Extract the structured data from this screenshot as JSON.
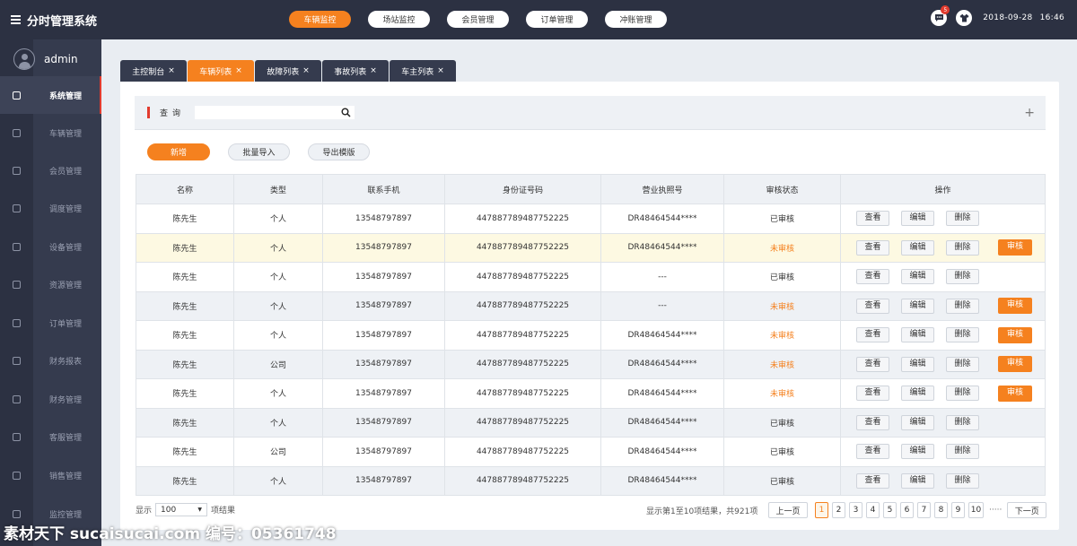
{
  "app": {
    "title": "分时管理系统"
  },
  "topnav": [
    {
      "label": "车辆监控",
      "active": true
    },
    {
      "label": "场站监控",
      "active": false
    },
    {
      "label": "会员管理",
      "active": false
    },
    {
      "label": "订单管理",
      "active": false
    },
    {
      "label": "冲账管理",
      "active": false
    }
  ],
  "header": {
    "message_count": "5",
    "date": "2018-09-28",
    "time": "16:46"
  },
  "user": {
    "name": "admin"
  },
  "sidebar": {
    "items": [
      {
        "label": "系统管理",
        "icon": "monitor-icon"
      },
      {
        "label": "车辆管理",
        "icon": "car-icon"
      },
      {
        "label": "会员管理",
        "icon": "member-card-icon"
      },
      {
        "label": "调度管理",
        "icon": "dispatch-icon"
      },
      {
        "label": "设备管理",
        "icon": "phone-icon"
      },
      {
        "label": "资源管理",
        "icon": "toolbox-icon"
      },
      {
        "label": "订单管理",
        "icon": "order-icon"
      },
      {
        "label": "财务报表",
        "icon": "report-icon"
      },
      {
        "label": "财务管理",
        "icon": "lock-icon"
      },
      {
        "label": "客服管理",
        "icon": "headset-icon"
      },
      {
        "label": "销售管理",
        "icon": "sales-icon"
      },
      {
        "label": "监控管理",
        "icon": "monitor-icon"
      }
    ]
  },
  "tabs": [
    {
      "label": "主控制台",
      "active": false
    },
    {
      "label": "车辆列表",
      "active": true
    },
    {
      "label": "故障列表",
      "active": false
    },
    {
      "label": "事故列表",
      "active": false
    },
    {
      "label": "车主列表",
      "active": false
    }
  ],
  "tab_close": "×",
  "search": {
    "label": "查询",
    "value": "",
    "plus": "+"
  },
  "actions": {
    "add": "新增",
    "import": "批量导入",
    "export": "导出模版"
  },
  "table": {
    "columns": [
      "名称",
      "类型",
      "联系手机",
      "身份证号码",
      "营业执照号",
      "审核状态",
      "操作"
    ],
    "ops": {
      "view": "查看",
      "edit": "编辑",
      "delete": "删除",
      "audit": "审核"
    },
    "rows": [
      {
        "name": "陈先生",
        "type": "个人",
        "phone": "13548797897",
        "id": "447887789487752225",
        "license": "DR48464544****",
        "status": "已审核",
        "pending": false
      },
      {
        "name": "陈先生",
        "type": "个人",
        "phone": "13548797897",
        "id": "447887789487752225",
        "license": "DR48464544****",
        "status": "未审核",
        "pending": true
      },
      {
        "name": "陈先生",
        "type": "个人",
        "phone": "13548797897",
        "id": "447887789487752225",
        "license": "---",
        "status": "已审核",
        "pending": false
      },
      {
        "name": "陈先生",
        "type": "个人",
        "phone": "13548797897",
        "id": "447887789487752225",
        "license": "---",
        "status": "未审核",
        "pending": true
      },
      {
        "name": "陈先生",
        "type": "个人",
        "phone": "13548797897",
        "id": "447887789487752225",
        "license": "DR48464544****",
        "status": "未审核",
        "pending": true
      },
      {
        "name": "陈先生",
        "type": "公司",
        "phone": "13548797897",
        "id": "447887789487752225",
        "license": "DR48464544****",
        "status": "未审核",
        "pending": true
      },
      {
        "name": "陈先生",
        "type": "个人",
        "phone": "13548797897",
        "id": "447887789487752225",
        "license": "DR48464544****",
        "status": "未审核",
        "pending": true
      },
      {
        "name": "陈先生",
        "type": "个人",
        "phone": "13548797897",
        "id": "447887789487752225",
        "license": "DR48464544****",
        "status": "已审核",
        "pending": false
      },
      {
        "name": "陈先生",
        "type": "公司",
        "phone": "13548797897",
        "id": "447887789487752225",
        "license": "DR48464544****",
        "status": "已审核",
        "pending": false
      },
      {
        "name": "陈先生",
        "type": "个人",
        "phone": "13548797897",
        "id": "447887789487752225",
        "license": "DR48464544****",
        "status": "已审核",
        "pending": false
      }
    ]
  },
  "footer": {
    "show_label": "显示",
    "page_size": "100",
    "result_label": "项结果",
    "info": "显示第1至10项结果，共921项",
    "prev": "上一页",
    "next": "下一页",
    "pages": [
      "1",
      "2",
      "3",
      "4",
      "5",
      "6",
      "7",
      "8",
      "9",
      "10"
    ],
    "current_page": "1",
    "ellipsis": "·····"
  },
  "watermark": "素材天下 sucaisucai.com  编号：05361748",
  "colors": {
    "accent": "#f5811f",
    "dark": "#2c3142",
    "sidebar": "#353b4e",
    "danger": "#e23b2e"
  }
}
